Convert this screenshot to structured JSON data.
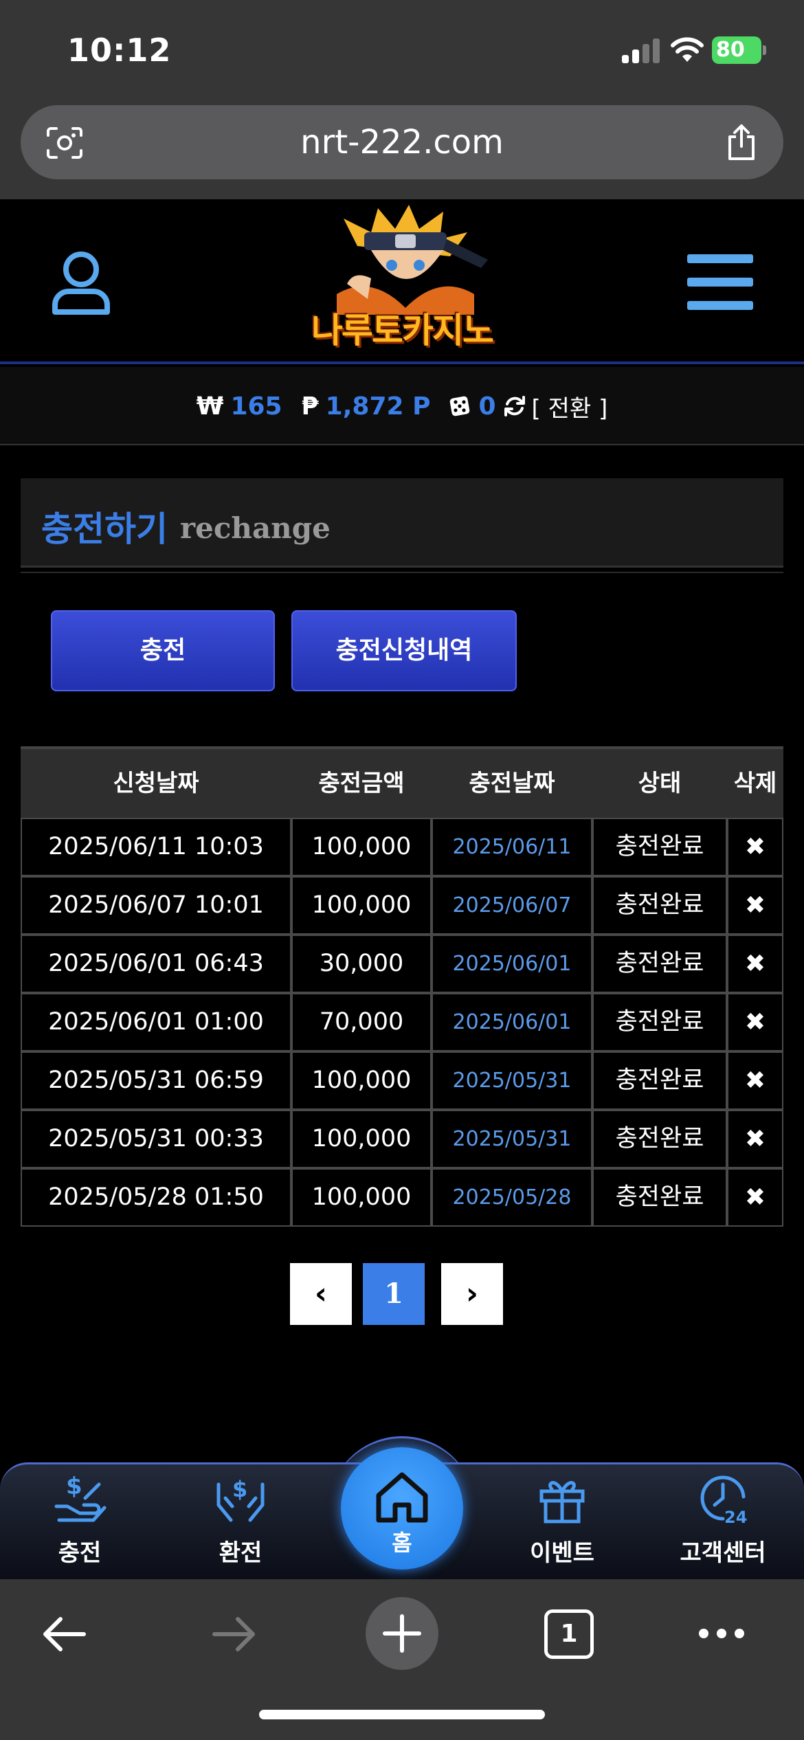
{
  "status_bar": {
    "time": "10:12",
    "battery": "80"
  },
  "browser": {
    "url": "nrt-222.com"
  },
  "header": {
    "logo_text": "나루토카지노"
  },
  "wallet": {
    "cash_symbol": "₩",
    "cash": "165",
    "point_symbol": "₱",
    "points": "1,872 P",
    "chips": "0",
    "switch_label": "[ 전환 ]"
  },
  "page": {
    "title_ko": "충전하기",
    "title_en": "rechange"
  },
  "buttons": {
    "charge": "충전",
    "history": "충전신청내역"
  },
  "table": {
    "headers": [
      "신청날짜",
      "충전금액",
      "충전날짜",
      "상태",
      "삭제"
    ],
    "rows": [
      {
        "request": "2025/06/11 10:03",
        "amount": "100,000",
        "charged": "2025/06/11",
        "status": "충전완료",
        "del": "✖"
      },
      {
        "request": "2025/06/07 10:01",
        "amount": "100,000",
        "charged": "2025/06/07",
        "status": "충전완료",
        "del": "✖"
      },
      {
        "request": "2025/06/01 06:43",
        "amount": "30,000",
        "charged": "2025/06/01",
        "status": "충전완료",
        "del": "✖"
      },
      {
        "request": "2025/06/01 01:00",
        "amount": "70,000",
        "charged": "2025/06/01",
        "status": "충전완료",
        "del": "✖"
      },
      {
        "request": "2025/05/31 06:59",
        "amount": "100,000",
        "charged": "2025/05/31",
        "status": "충전완료",
        "del": "✖"
      },
      {
        "request": "2025/05/31 00:33",
        "amount": "100,000",
        "charged": "2025/05/31",
        "status": "충전완료",
        "del": "✖"
      },
      {
        "request": "2025/05/28 01:50",
        "amount": "100,000",
        "charged": "2025/05/28",
        "status": "충전완료",
        "del": "✖"
      }
    ]
  },
  "pagination": {
    "prev": "‹",
    "current": "1",
    "next": "›"
  },
  "bottom_nav": {
    "charge": "충전",
    "exchange": "환전",
    "home": "홈",
    "event": "이벤트",
    "support": "고객센터"
  },
  "toolbar": {
    "tabs_count": "1"
  },
  "colors": {
    "accent": "#3b7ee8",
    "button": "#2a3bc4",
    "link": "#5c9bea"
  }
}
